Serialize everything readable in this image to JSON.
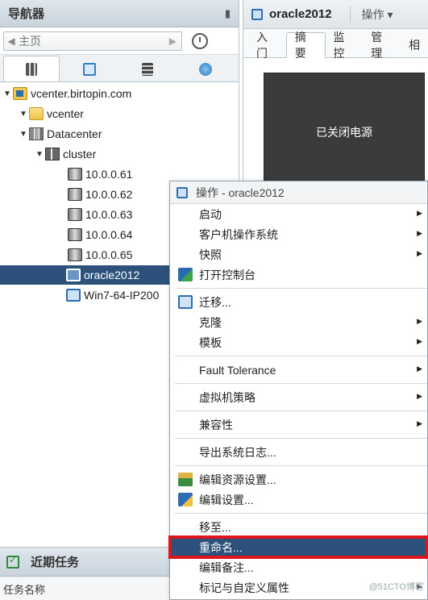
{
  "navigator": {
    "title": "导航器",
    "pin_icon": "pin-icon",
    "back_label": "主页",
    "tabs": [
      {
        "icon": "hosts-clusters-icon"
      },
      {
        "icon": "vms-templates-icon"
      },
      {
        "icon": "storage-icon"
      },
      {
        "icon": "networking-icon"
      }
    ],
    "tree": [
      {
        "label": "vcenter.birtopin.com",
        "icon": "vcenter-icon",
        "toggle": "▼"
      },
      {
        "label": "vcenter",
        "icon": "folder-icon",
        "toggle": "▼"
      },
      {
        "label": "Datacenter",
        "icon": "datacenter-icon",
        "toggle": "▼"
      },
      {
        "label": "cluster",
        "icon": "cluster-icon",
        "toggle": "▼"
      },
      {
        "label": "10.0.0.61",
        "icon": "host-icon"
      },
      {
        "label": "10.0.0.62",
        "icon": "host-icon"
      },
      {
        "label": "10.0.0.63",
        "icon": "host-icon"
      },
      {
        "label": "10.0.0.64",
        "icon": "host-icon"
      },
      {
        "label": "10.0.0.65",
        "icon": "host-icon"
      },
      {
        "label": "oracle2012",
        "icon": "vm-icon",
        "selected": true
      },
      {
        "label": "Win7-64-IP200",
        "icon": "vm-icon"
      }
    ]
  },
  "recent_tasks": {
    "title": "近期任务",
    "column_task_name": "任务名称"
  },
  "object": {
    "title": "oracle2012",
    "actions_label": "操作 ▾",
    "tabs": [
      "入门",
      "摘要",
      "监控",
      "管理",
      "相"
    ],
    "active_tab": "摘要",
    "console_text": "已关闭电源"
  },
  "context_menu": {
    "title": "操作 - oracle2012",
    "items": [
      {
        "label": "启动",
        "submenu": true
      },
      {
        "label": "客户机操作系统",
        "submenu": true
      },
      {
        "label": "快照",
        "submenu": true
      },
      {
        "label": "打开控制台",
        "icon": "console-icon"
      },
      {
        "label": "迁移...",
        "icon": "migrate-icon"
      },
      {
        "label": "克隆",
        "submenu": true
      },
      {
        "label": "模板",
        "submenu": true
      },
      {
        "label": "Fault Tolerance",
        "submenu": true
      },
      {
        "label": "虚拟机策略",
        "submenu": true
      },
      {
        "label": "兼容性",
        "submenu": true
      },
      {
        "label": "导出系统日志..."
      },
      {
        "label": "编辑资源设置...",
        "icon": "resource-settings-icon"
      },
      {
        "label": "编辑设置...",
        "icon": "edit-settings-icon"
      },
      {
        "label": "移至..."
      },
      {
        "label": "重命名...",
        "highlighted": true
      },
      {
        "label": "编辑备注..."
      },
      {
        "label": "标记与自定义属性",
        "submenu": true
      }
    ]
  },
  "watermark": "@51CTO博客",
  "colors": {
    "selection": "#2c527b",
    "highlight_border": "#e0141b",
    "header_bg": "#c9d3dc"
  }
}
